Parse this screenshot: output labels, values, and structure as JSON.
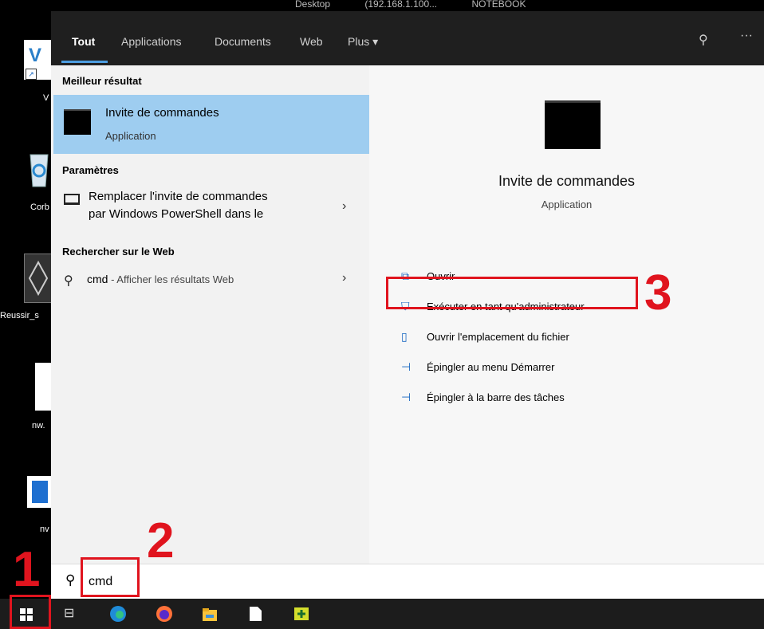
{
  "titlebar": {
    "parts": [
      "Desktop",
      "(192.168.1.100...",
      "NOTEBOOK"
    ]
  },
  "desktop": {
    "icons": [
      {
        "label": "V"
      },
      {
        "label": "Corb"
      },
      {
        "label": "Reussir_s"
      },
      {
        "label": "nw."
      },
      {
        "label": "nv"
      }
    ]
  },
  "tabs": [
    {
      "label": "Tout"
    },
    {
      "label": "Applications"
    },
    {
      "label": "Documents"
    },
    {
      "label": "Web"
    },
    {
      "label": "Plus ▾"
    }
  ],
  "left": {
    "best_header": "Meilleur résultat",
    "best_title": "Invite de commandes",
    "best_sub": "Application",
    "settings_header": "Paramètres",
    "settings_line1": "Remplacer l'invite de commandes",
    "settings_line2": "par Windows PowerShell dans le",
    "web_header": "Rechercher sur le Web",
    "web_query": "cmd",
    "web_suffix": " - Afficher les résultats Web"
  },
  "right": {
    "title": "Invite de commandes",
    "subtitle": "Application",
    "actions": [
      {
        "label": "Ouvrir",
        "icon": "open-icon"
      },
      {
        "label": "Exécuter en tant qu'administrateur",
        "icon": "admin-shield-icon"
      },
      {
        "label": "Ouvrir l'emplacement du fichier",
        "icon": "folder-icon"
      },
      {
        "label": "Épingler au menu Démarrer",
        "icon": "pin-icon"
      },
      {
        "label": "Épingler à la barre des tâches",
        "icon": "pin-icon"
      }
    ]
  },
  "search": {
    "value": "cmd"
  },
  "annotations": {
    "n1": "1",
    "n2": "2",
    "n3": "3",
    "color": "#e0141e"
  },
  "colors": {
    "accent": "#4c9de0",
    "selection": "#9ecdf0"
  }
}
